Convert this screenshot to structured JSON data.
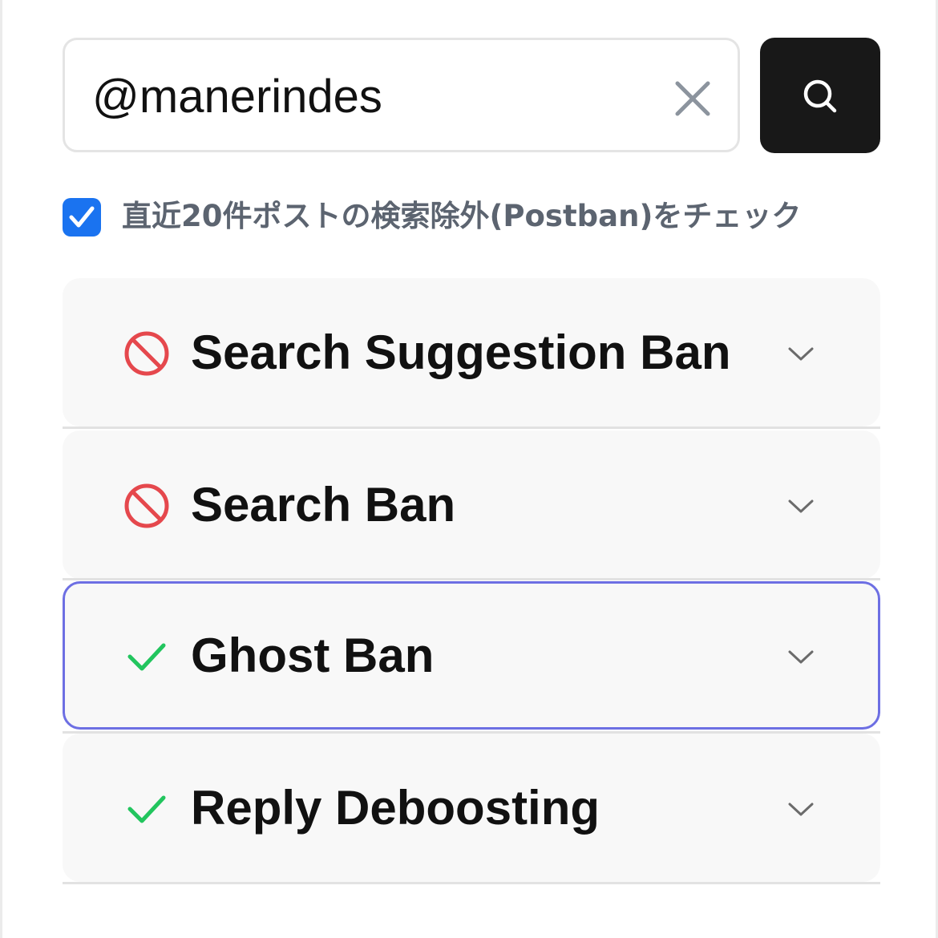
{
  "search": {
    "value": "@manerindes",
    "clear_icon": "x-icon",
    "button_icon": "search-icon"
  },
  "option": {
    "checked": true,
    "label": "直近20件ポストの検索除外(Postban)をチェック"
  },
  "colors": {
    "accent_blue": "#1a73f0",
    "ban_red": "#e5484d",
    "ok_green": "#22c55e",
    "active_border": "#6d6fe3"
  },
  "results": [
    {
      "title": "Search Suggestion Ban",
      "status": "banned",
      "icon": "prohibited-icon"
    },
    {
      "title": "Search Ban",
      "status": "banned",
      "icon": "prohibited-icon"
    },
    {
      "title": "Ghost Ban",
      "status": "clear",
      "icon": "checkmark-icon",
      "active": true
    },
    {
      "title": "Reply Deboosting",
      "status": "clear",
      "icon": "checkmark-icon"
    }
  ]
}
